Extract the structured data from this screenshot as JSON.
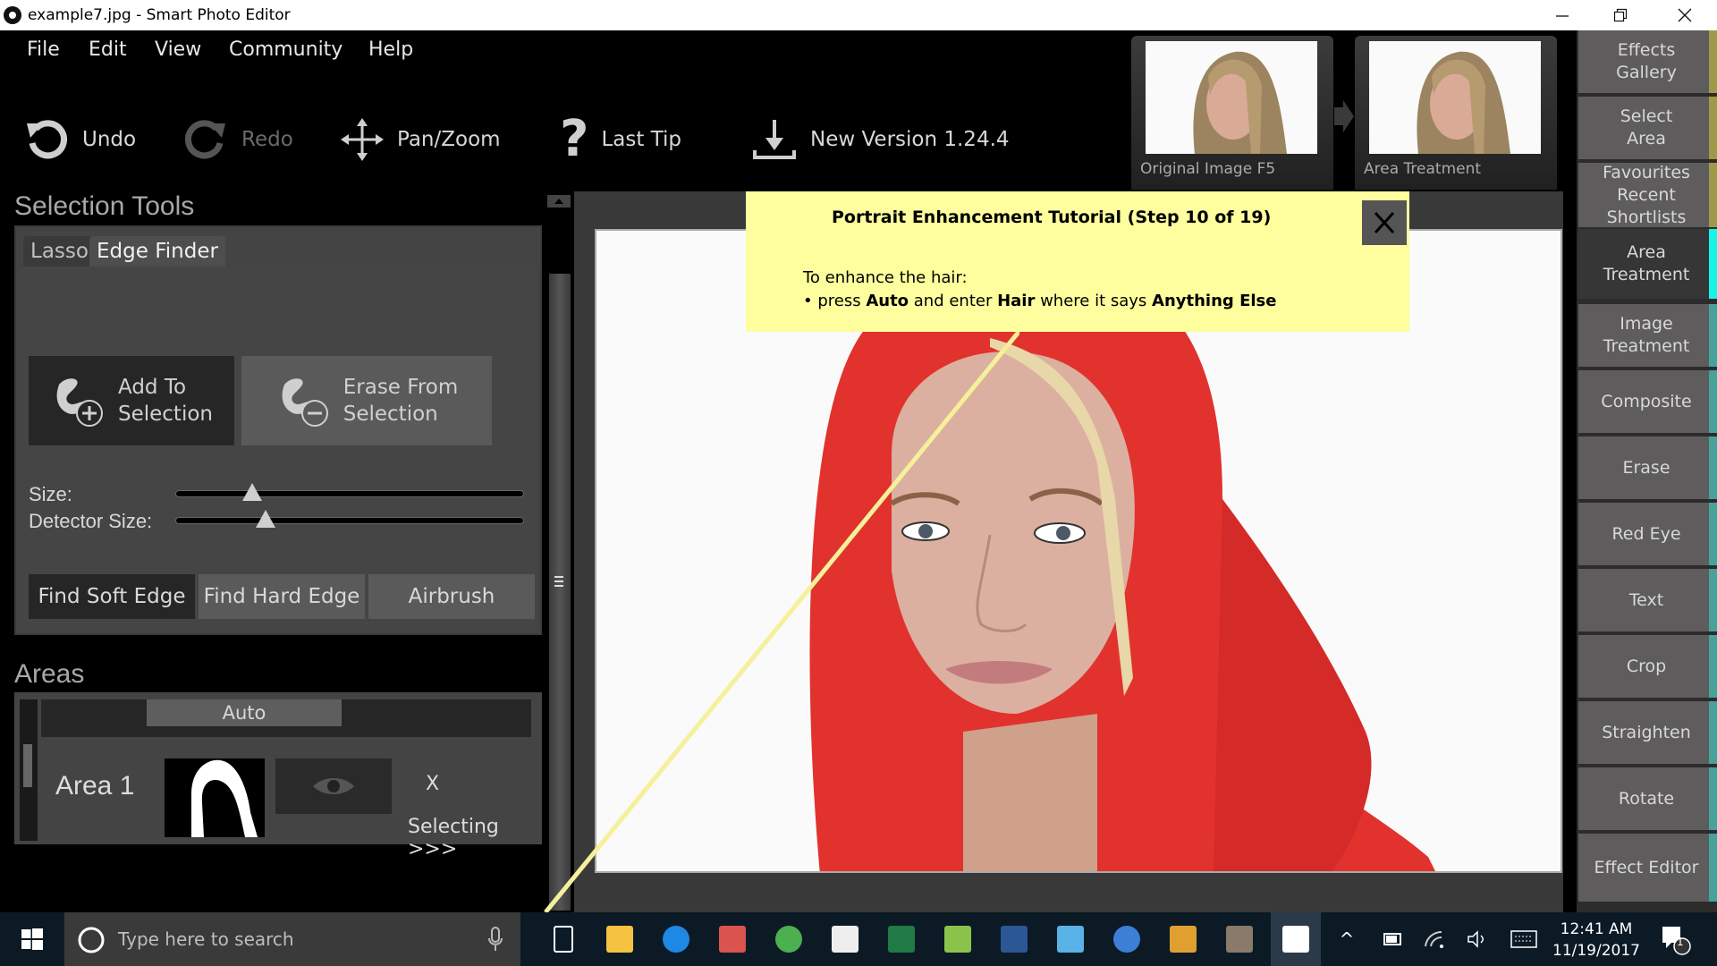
{
  "window": {
    "title": "example7.jpg - Smart Photo Editor",
    "controls": [
      "minimize",
      "restore",
      "close"
    ]
  },
  "menu": [
    "File",
    "Edit",
    "View",
    "Community",
    "Help"
  ],
  "toolbar": {
    "undo": "Undo",
    "redo": "Redo",
    "pan_zoom": "Pan/Zoom",
    "last_tip": "Last Tip",
    "new_version": "New Version 1.24.4"
  },
  "history": {
    "thumbs": [
      {
        "label": "Original Image F5"
      },
      {
        "label": "Area Treatment"
      }
    ]
  },
  "selection_tools": {
    "title": "Selection Tools",
    "tabs": [
      {
        "label": "Lasso",
        "active": false
      },
      {
        "label": "Edge Finder",
        "active": true
      }
    ],
    "add_button": "Add To Selection",
    "add_line1": "Add To",
    "add_line2": "Selection",
    "erase_line1": "Erase From",
    "erase_line2": "Selection",
    "size_label": "Size:",
    "size_value_pct": 22,
    "detector_label": "Detector Size:",
    "detector_value_pct": 26,
    "edge_buttons": [
      {
        "label": "Find Soft Edge",
        "active": true
      },
      {
        "label": "Find Hard Edge",
        "active": false
      },
      {
        "label": "Airbrush",
        "active": false
      }
    ]
  },
  "areas": {
    "title": "Areas",
    "auto_button": "Auto",
    "items": [
      {
        "name": "Area 1",
        "status": "Selecting >>>",
        "remove": "X"
      }
    ]
  },
  "tutorial": {
    "title": "Portrait Enhancement Tutorial (Step 10 of 19)",
    "step": 10,
    "total_steps": 19,
    "line1": "To enhance the hair:",
    "bullet_parts": [
      {
        "text": "press ",
        "bold": false
      },
      {
        "text": "Auto",
        "bold": true
      },
      {
        "text": " and enter ",
        "bold": false
      },
      {
        "text": "Hair",
        "bold": true
      },
      {
        "text": " where it says ",
        "bold": false
      },
      {
        "text": "Anything Else",
        "bold": true
      }
    ],
    "close": "X"
  },
  "right_panel": {
    "items": [
      {
        "label": "Effects Gallery",
        "l1": "Effects",
        "l2": "Gallery",
        "accent": "#a09a48",
        "active": false
      },
      {
        "label": "Select Area",
        "l1": "Select",
        "l2": "Area",
        "accent": "#a09a48",
        "active": false
      },
      {
        "label": "Favourites Recent Shortlists",
        "l1": "Favourites",
        "l2": "Recent",
        "l3": "Shortlists",
        "accent": "#a09a48",
        "active": false
      },
      {
        "label": "Area Treatment",
        "l1": "Area",
        "l2": "Treatment",
        "accent": "#17f5e8",
        "active": true
      },
      {
        "label": "Image Treatment",
        "l1": "Image",
        "l2": "Treatment",
        "accent": "#45a39b",
        "active": false
      },
      {
        "label": "Composite",
        "l1": "Composite",
        "accent": "#45a39b",
        "active": false
      },
      {
        "label": "Erase",
        "l1": "Erase",
        "accent": "#45a39b",
        "active": false
      },
      {
        "label": "Red Eye",
        "l1": "Red Eye",
        "accent": "#45a39b",
        "active": false
      },
      {
        "label": "Text",
        "l1": "Text",
        "accent": "#45a39b",
        "active": false
      },
      {
        "label": "Crop",
        "l1": "Crop",
        "accent": "#45a39b",
        "active": false
      },
      {
        "label": "Straighten",
        "l1": "Straighten",
        "accent": "#45a39b",
        "active": false
      },
      {
        "label": "Rotate",
        "l1": "Rotate",
        "accent": "#45a39b",
        "active": false
      },
      {
        "label": "Effect Editor",
        "l1": "Effect Editor",
        "accent": "#45a39b",
        "active": false
      }
    ]
  },
  "taskbar": {
    "search_placeholder": "Type here to search",
    "apps": [
      "task-view",
      "file-explorer",
      "edge",
      "snipping-tool",
      "chrome",
      "calculator",
      "excel",
      "photo-viewer",
      "word",
      "paint",
      "media-player",
      "camera-app",
      "gimp",
      "smart-photo-editor"
    ],
    "time": "12:41 AM",
    "date": "11/19/2017",
    "notifications": "1"
  },
  "colors": {
    "tutorial_bg": "#fefe9e",
    "hair_overlay": "#e8322e",
    "accent_olive": "#a09a48",
    "accent_active": "#17f5e8",
    "accent_teal": "#45a39b"
  }
}
